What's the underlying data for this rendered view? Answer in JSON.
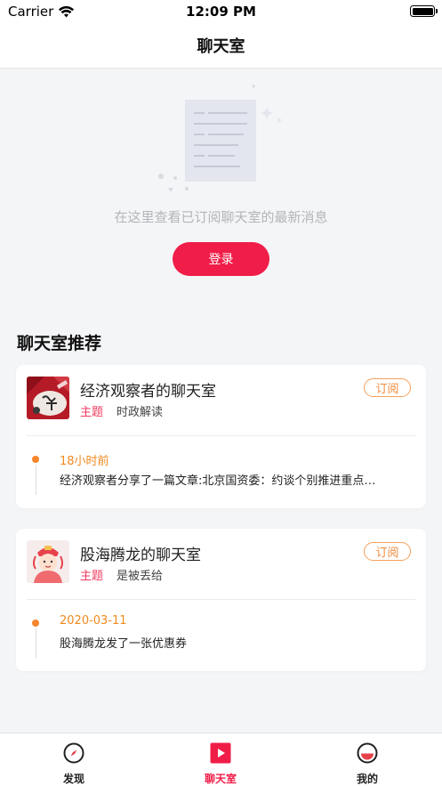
{
  "status_bar": {
    "carrier": "Carrier",
    "time": "12:09 PM"
  },
  "nav": {
    "title": "聊天室"
  },
  "empty_state": {
    "message": "在这里查看已订阅聊天室的最新消息",
    "login_label": "登录"
  },
  "section": {
    "title": "聊天室推荐"
  },
  "rooms": [
    {
      "name": "经济观察者的聊天室",
      "topic_label": "主题",
      "topic_value": "时政解读",
      "subscribe_label": "订阅",
      "message_time": "18小时前",
      "message_text": "经济观察者分享了一篇文章:北京国资委：约谈个别推进重点…"
    },
    {
      "name": "股海腾龙的聊天室",
      "topic_label": "主题",
      "topic_value": "是被丢给",
      "subscribe_label": "订阅",
      "message_time": "2020-03-11",
      "message_text": "股海腾龙发了一张优惠券"
    }
  ],
  "tabs": [
    {
      "label": "发现",
      "icon": "compass-icon",
      "color": "#222222"
    },
    {
      "label": "聊天室",
      "icon": "play-square-icon",
      "color": "#f01d48"
    },
    {
      "label": "我的",
      "icon": "profile-circle-icon",
      "color": "#222222"
    }
  ],
  "colors": {
    "accent": "#f01d48",
    "subscribe": "#f08a3c",
    "timeline": "#f7852c"
  }
}
